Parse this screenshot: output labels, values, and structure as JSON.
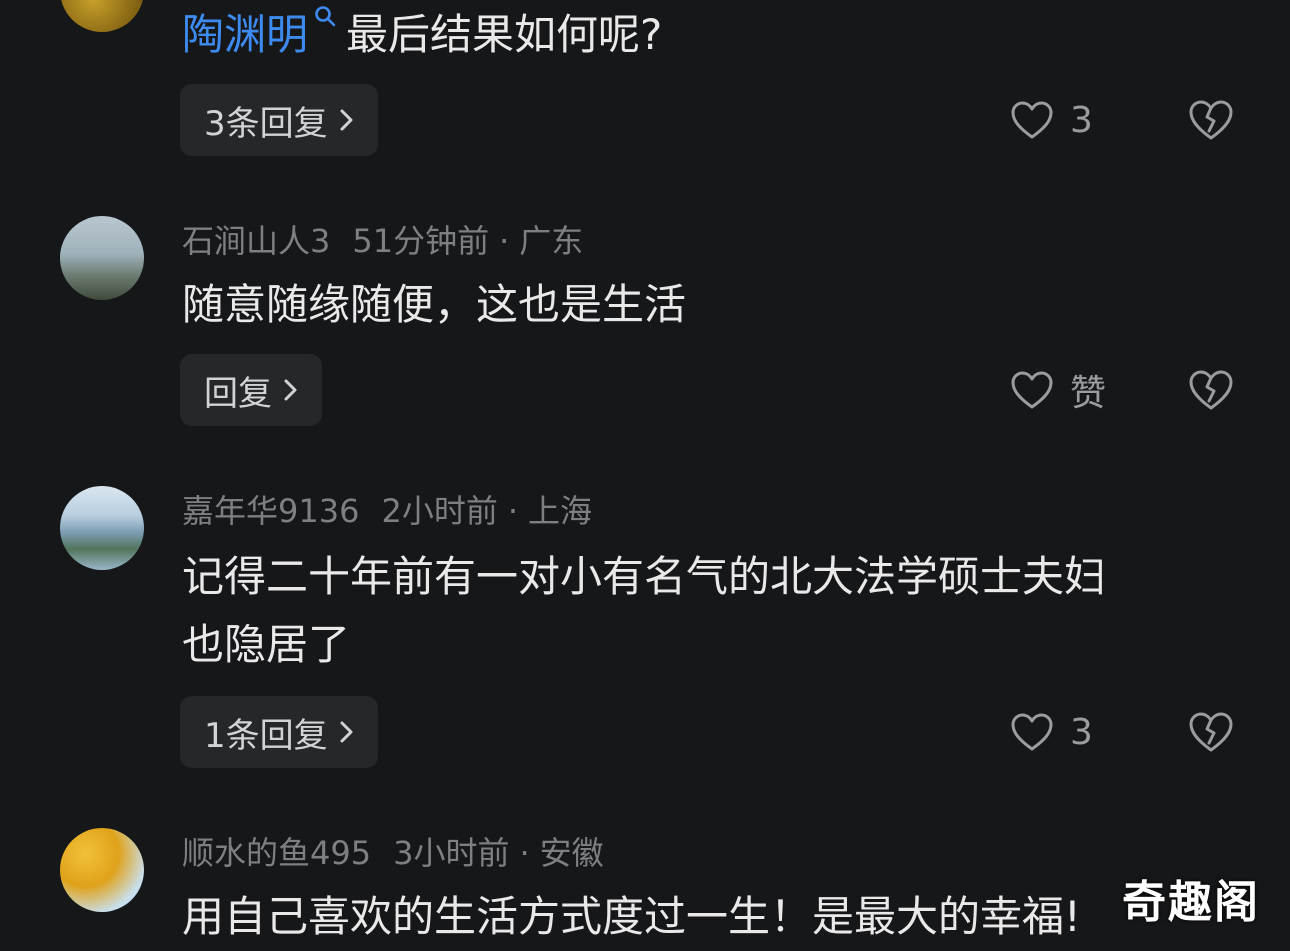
{
  "comments": [
    {
      "mention": "陶渊明",
      "text": "最后结果如何呢?",
      "replies_label": "3条回复",
      "likes": "3"
    },
    {
      "username": "石涧山人3",
      "time": "51分钟前",
      "separator": "·",
      "location": "广东",
      "text": "随意随缘随便，这也是生活",
      "replies_label": "回复",
      "likes": "赞"
    },
    {
      "username": "嘉年华9136",
      "time": "2小时前",
      "separator": "·",
      "location": "上海",
      "text_line1": "记得二十年前有一对小有名气的北大法学硕士夫妇",
      "text_line2": "也隐居了",
      "replies_label": "1条回复",
      "likes": "3"
    },
    {
      "username": "顺水的鱼495",
      "time": "3小时前",
      "separator": "·",
      "location": "安徽",
      "text": "用自己喜欢的生活方式度过一生！是最大的幸福!"
    }
  ],
  "watermark": "奇趣阁",
  "colors": {
    "background": "#161719",
    "mention": "#3d8bf0",
    "meta": "#7d7f83",
    "button_bg": "#26272a"
  },
  "icons": [
    "search-icon",
    "chevron-right-icon",
    "heart-icon",
    "broken-heart-icon"
  ]
}
